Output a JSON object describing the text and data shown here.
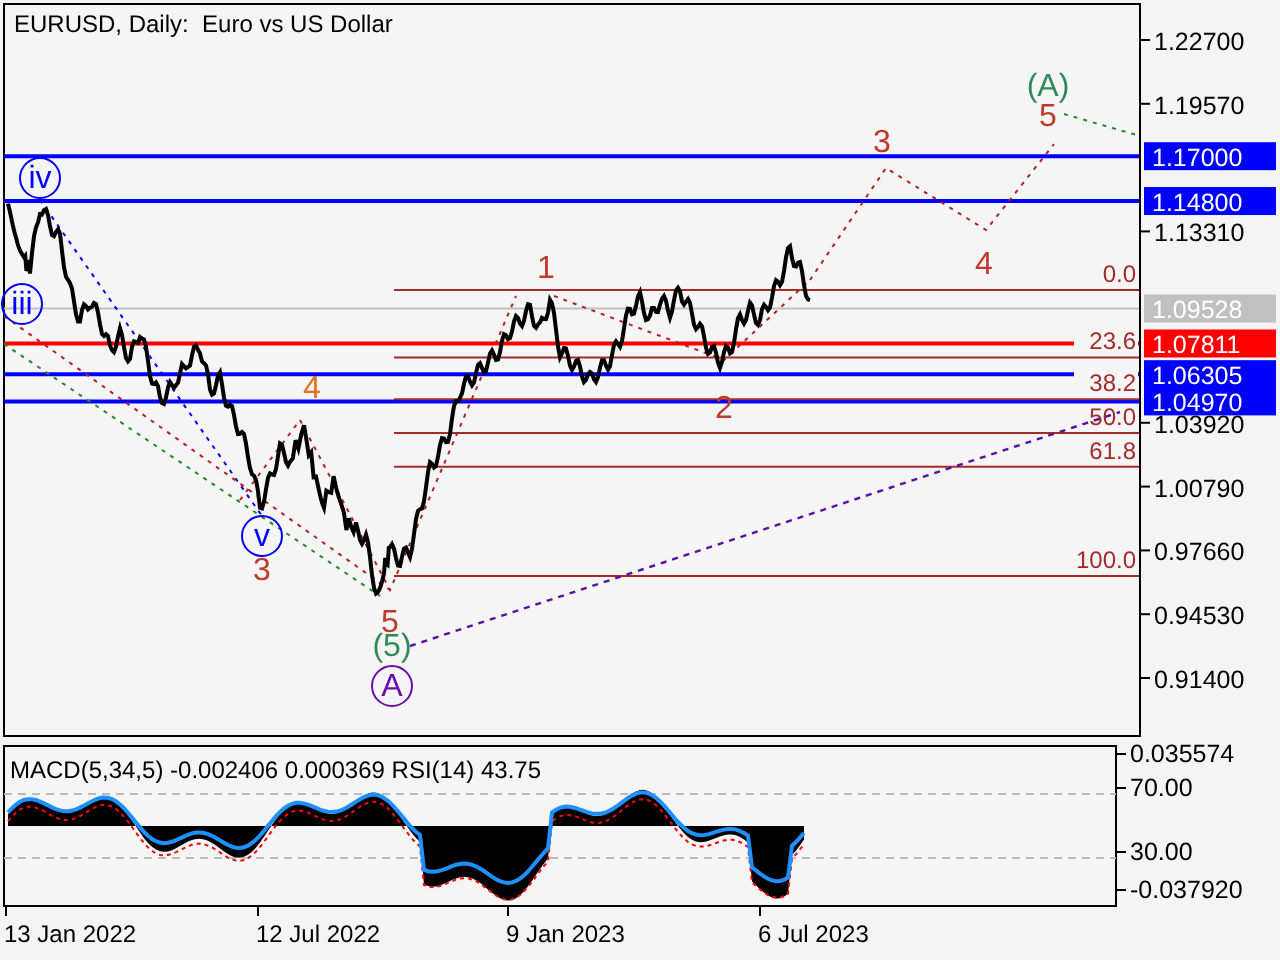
{
  "chart": {
    "title": "EURUSD, Daily:  Euro vs US Dollar",
    "price_axis": [
      "1.22700",
      "1.19570",
      "1.13310",
      "1.03920",
      "1.00790",
      "0.97660",
      "0.94530",
      "0.91400"
    ],
    "price_levels": [
      {
        "label": "1.17000",
        "color": "#0000ff"
      },
      {
        "label": "1.14800",
        "color": "#0000ff"
      },
      {
        "label": "1.09528",
        "color": "#c0c0c0"
      },
      {
        "label": "1.07811",
        "color": "#ff0000"
      },
      {
        "label": "1.06305",
        "color": "#0000ff"
      },
      {
        "label": "1.04970",
        "color": "#0000ff"
      }
    ],
    "fib_levels": [
      "0.0",
      "23.6",
      "38.2",
      "50.0",
      "61.8",
      "100.0"
    ],
    "wave_labels": [
      {
        "text": "iv",
        "color": "#0000ff",
        "circled": true
      },
      {
        "text": "iii",
        "color": "#0000ff",
        "circled": true
      },
      {
        "text": "v",
        "color": "#0000ff",
        "circled": true
      },
      {
        "text": "3",
        "color": "#c0392b",
        "circled": false
      },
      {
        "text": "4",
        "color": "#e07020",
        "circled": false
      },
      {
        "text": "5",
        "color": "#c0392b",
        "circled": false
      },
      {
        "text": "(5)",
        "color": "#2e8b57",
        "circled": false
      },
      {
        "text": "A",
        "color": "#6a0dad",
        "circled": true
      },
      {
        "text": "1",
        "color": "#c0392b",
        "circled": false
      },
      {
        "text": "2",
        "color": "#c0392b",
        "circled": false
      },
      {
        "text": "3",
        "color": "#c0392b",
        "circled": false
      },
      {
        "text": "4",
        "color": "#c0392b",
        "circled": false
      },
      {
        "text": "5",
        "color": "#c0392b",
        "circled": false
      },
      {
        "text": "(A)",
        "color": "#2e8b57",
        "circled": false
      }
    ]
  },
  "indicator": {
    "title": "MACD(5,34,5) -0.002406 0.000369 RSI(14) 43.75",
    "axis": [
      "0.035574",
      "70.00",
      "30.00",
      "-0.037920"
    ]
  },
  "time_axis": [
    "13 Jan 2022",
    "12 Jul 2022",
    "9 Jan 2023",
    "6 Jul 2023"
  ]
}
